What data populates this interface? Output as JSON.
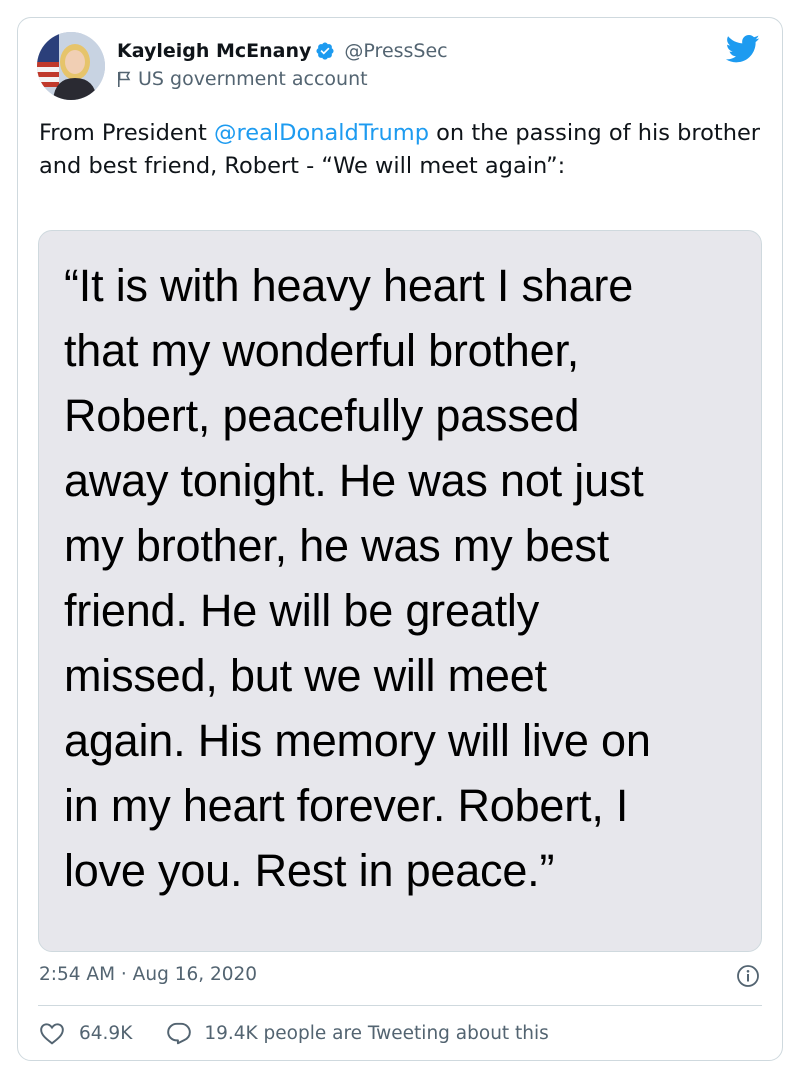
{
  "author": {
    "display_name": "Kayleigh McEnany",
    "handle": "@PressSec",
    "government_label": "US government account",
    "verified": true
  },
  "tweet": {
    "text_before": "From President ",
    "mention": "@realDonaldTrump",
    "text_after": " on the passing of his brother and best friend, Robert - “We will meet again”:"
  },
  "media": {
    "lines": [
      "“It is with heavy heart I share",
      "that my wonderful brother,",
      "Robert, peacefully passed",
      "away tonight.  He was not just",
      "my brother, he was my best",
      "friend. He will be greatly",
      "missed, but we will meet",
      "again. His memory will live on",
      "in my heart forever. Robert, I",
      "love you. Rest in peace.”"
    ]
  },
  "timestamp": "2:54 AM · Aug 16, 2020",
  "actions": {
    "like_count": "64.9K",
    "tweeting_text": "19.4K people are Tweeting about this"
  },
  "icons": {
    "brand": "twitter-bird-icon",
    "verified": "verified-badge-icon",
    "government": "flag-icon",
    "info": "info-icon",
    "like": "heart-icon",
    "reply": "reply-icon"
  },
  "colors": {
    "accent": "#1d9bf0",
    "secondary_text": "#536471",
    "border": "#cfd9de",
    "media_background": "#e7e7ec"
  }
}
